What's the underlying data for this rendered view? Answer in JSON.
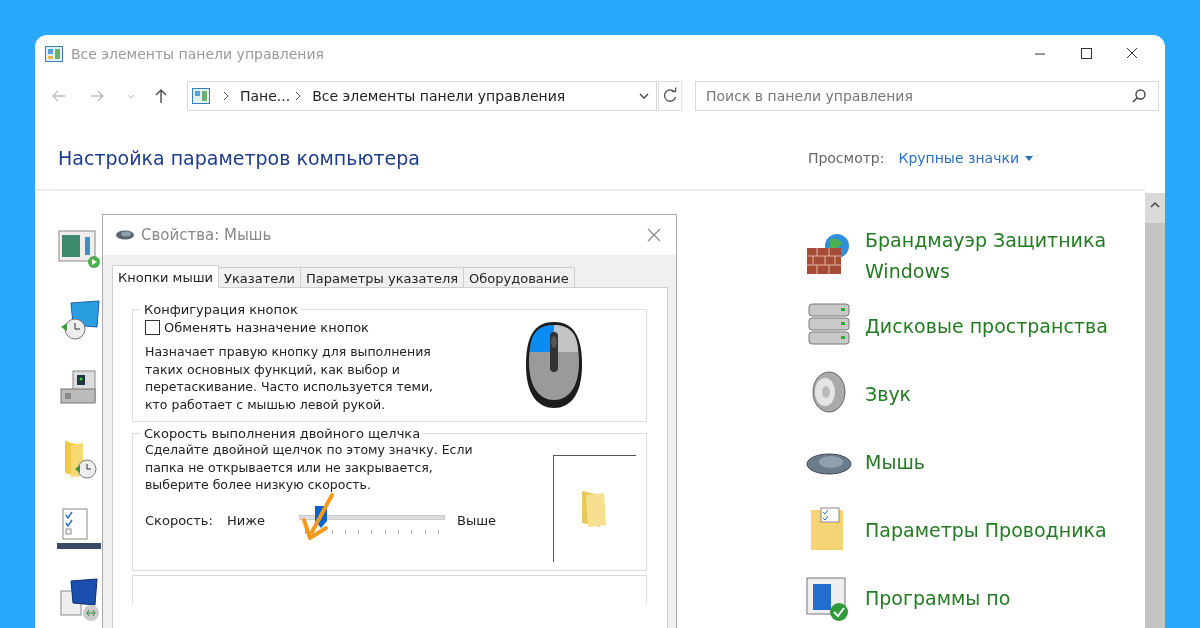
{
  "window": {
    "title": "Все элементы панели управления"
  },
  "address_bar": {
    "crumbs": [
      "Пане...",
      "Все элементы панели управления"
    ]
  },
  "search": {
    "placeholder": "Поиск в панели управления"
  },
  "header": {
    "title": "Настройка параметров компьютера",
    "view_label": "Просмотр:",
    "view_value": "Крупные значки"
  },
  "items": [
    {
      "kind": "firewall",
      "label": "Брандмауэр Защитника Windows"
    },
    {
      "kind": "storage",
      "label": "Дисковые пространства"
    },
    {
      "kind": "sound",
      "label": "Звук"
    },
    {
      "kind": "mouse",
      "label": "Мышь"
    },
    {
      "kind": "folder",
      "label": "Параметры Проводника"
    },
    {
      "kind": "defaults",
      "label": "Программы по"
    }
  ],
  "dialog": {
    "title": "Свойства: Мышь",
    "tabs": [
      {
        "label": "Кнопки мыши",
        "selected": true
      },
      {
        "label": "Указатели",
        "selected": false
      },
      {
        "label": "Параметры указателя",
        "selected": false
      },
      {
        "label": "Оборудование",
        "selected": false
      }
    ],
    "buttons_group": {
      "title": "Конфигурация кнопок",
      "checkbox": {
        "label": "Обменять назначение кнопок",
        "checked": false
      },
      "description": "Назначает правую кнопку для выполнения таких основных функций, как выбор и перетаскивание. Часто используется теми, кто работает с мышью левой рукой."
    },
    "speed_group": {
      "title": "Скорость выполнения двойного щелчка",
      "description": "Сделайте двойной щелчок по этому значку. Если папка не открывается или не закрывается, выберите более низкую скорость.",
      "speed_label": "Скорость:",
      "low_label": "Ниже",
      "high_label": "Выше",
      "level": 0.15
    }
  }
}
